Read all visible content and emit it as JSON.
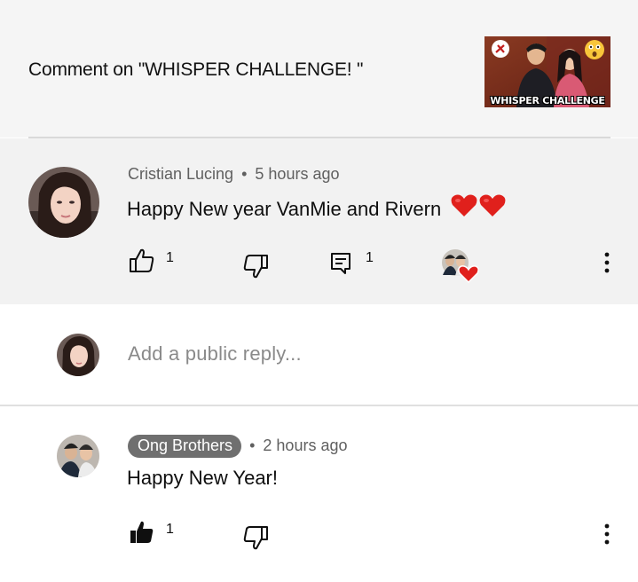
{
  "header": {
    "title": "Comment on \"WHISPER CHALLENGE! \"",
    "thumbnail_caption": "WHISPER CHALLENGE"
  },
  "comment": {
    "author": "Cristian Lucing",
    "separator": "•",
    "time": "5 hours ago",
    "text": "Happy New year VanMie and Rivern",
    "like_count": "1",
    "reply_count": "1"
  },
  "reply_box": {
    "placeholder": "Add a public reply..."
  },
  "reply": {
    "author": "Ong Brothers",
    "separator": "•",
    "time": "2 hours ago",
    "text": "Happy New Year!",
    "like_count": "1"
  },
  "colors": {
    "heart": "#e0201c",
    "header_bg": "#f5f5f5",
    "comment_bg": "#f2f2f2",
    "owner_badge": "#6f6f6f"
  }
}
